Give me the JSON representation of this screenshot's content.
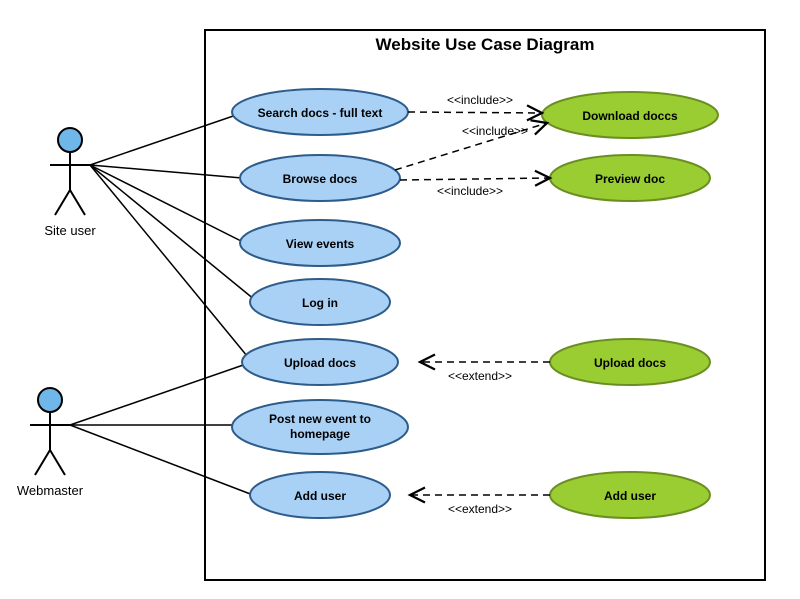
{
  "title": "Website Use Case Diagram",
  "actors": {
    "siteUser": {
      "label": "Site user"
    },
    "webmaster": {
      "label": "Webmaster"
    }
  },
  "useCases": {
    "searchDocs": {
      "label": "Search docs - full text"
    },
    "browseDocs": {
      "label": "Browse docs"
    },
    "viewEvents": {
      "label": "View events"
    },
    "logIn": {
      "label": "Log in"
    },
    "uploadDocs": {
      "label": "Upload docs"
    },
    "postEvent": {
      "label1": "Post new event to",
      "label2": "homepage"
    },
    "addUser": {
      "label": "Add user"
    },
    "downloadDocs": {
      "label": "Download doccs"
    },
    "previewDoc": {
      "label": "Preview doc"
    },
    "uploadDocsExt": {
      "label": "Upload docs"
    },
    "addUserExt": {
      "label": "Add user"
    }
  },
  "relations": {
    "inc1": {
      "label": "<<include>>"
    },
    "inc2": {
      "label": "<<include>>"
    },
    "inc3": {
      "label": "<<include>>"
    },
    "ext1": {
      "label": "<<extend>>"
    },
    "ext2": {
      "label": "<<extend>>"
    }
  },
  "colors": {
    "blueFill": "#A9D0F5",
    "blueStroke": "#2E5C8A",
    "greenFill": "#9ACD32",
    "greenStroke": "#6B8E23",
    "actorHead": "#6FB7E9",
    "black": "#000000"
  }
}
